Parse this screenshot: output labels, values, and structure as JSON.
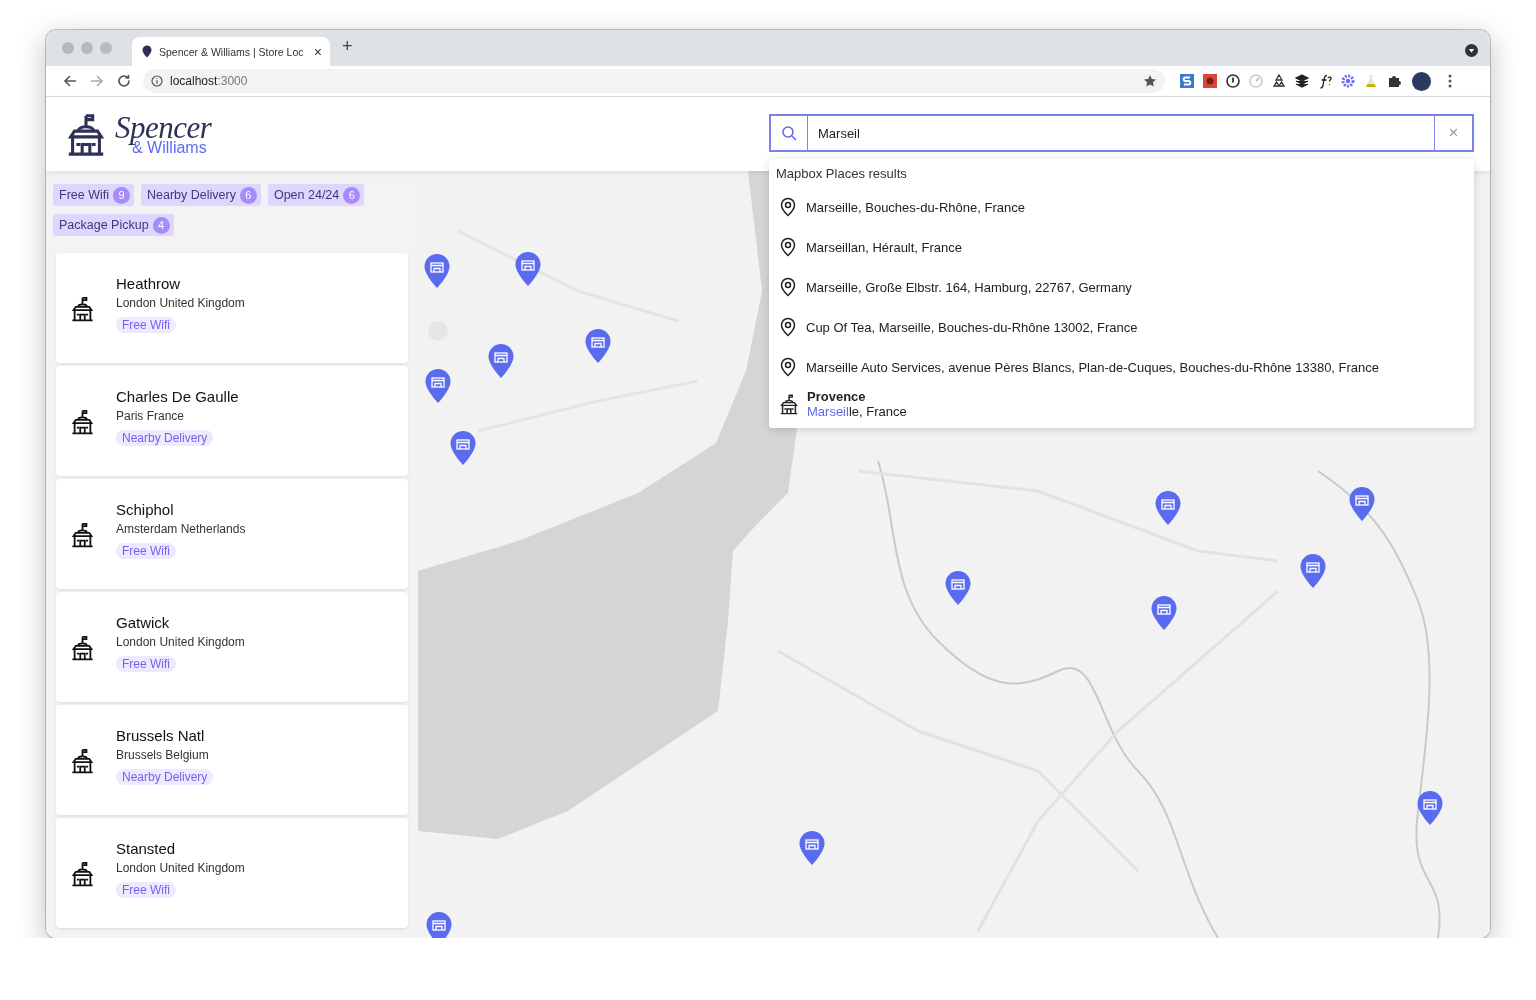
{
  "browser": {
    "tab_title": "Spencer & Williams | Store Loc",
    "tab_close": "×",
    "new_tab": "+",
    "url_host": "localhost",
    "url_port": ":3000"
  },
  "brand": {
    "name": "Spencer",
    "sub": "& Williams"
  },
  "search": {
    "value": "Marseil",
    "clear": "×"
  },
  "filters": [
    {
      "label": "Free Wifi",
      "count": "9"
    },
    {
      "label": "Nearby Delivery",
      "count": "6"
    },
    {
      "label": "Open 24/24",
      "count": "6"
    },
    {
      "label": "Package Pickup",
      "count": "4"
    }
  ],
  "stores": [
    {
      "name": "Heathrow",
      "location": "London United Kingdom",
      "tag": "Free Wifi"
    },
    {
      "name": "Charles De Gaulle",
      "location": "Paris France",
      "tag": "Nearby Delivery"
    },
    {
      "name": "Schiphol",
      "location": "Amsterdam Netherlands",
      "tag": "Free Wifi"
    },
    {
      "name": "Gatwick",
      "location": "London United Kingdom",
      "tag": "Free Wifi"
    },
    {
      "name": "Brussels Natl",
      "location": "Brussels Belgium",
      "tag": "Nearby Delivery"
    },
    {
      "name": "Stansted",
      "location": "London United Kingdom",
      "tag": "Free Wifi"
    }
  ],
  "results": {
    "heading": "Mapbox Places results",
    "places": [
      "Marseille, Bouches-du-Rhône, France",
      "Marseillan, Hérault, France",
      "Marseille, Große Elbstr. 164, Hamburg, 22767, Germany",
      "Cup Of Tea, Marseille, Bouches-du-Rhône 13002, France",
      "Marseille Auto Services, avenue Pères Blancs, Plan-de-Cuques, Bouches-du-Rhône 13380, France"
    ],
    "stores": [
      {
        "name": "Provence",
        "match": "Marseil",
        "rest": "le, France"
      }
    ]
  }
}
